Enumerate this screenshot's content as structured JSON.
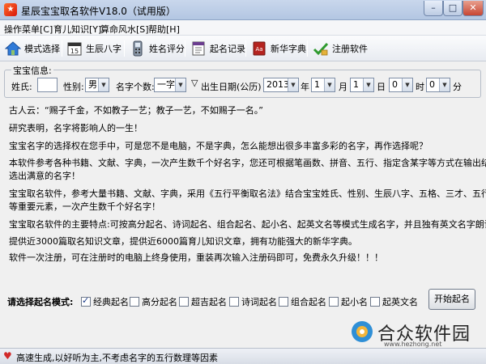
{
  "window": {
    "title": "星辰宝宝取名软件V18.0（试用版）",
    "app_icon": "star-app-icon",
    "buttons": {
      "minimize": "–",
      "maximize": "□",
      "close": "✕"
    }
  },
  "menu": [
    "操作菜单[C]",
    "育儿知识[Y]",
    "算命风水[S]",
    "帮助[H]"
  ],
  "toolbar": [
    {
      "label": "模式选择",
      "icon": "house-icon"
    },
    {
      "label": "生辰八字",
      "icon": "calendar-icon"
    },
    {
      "label": "姓名评分",
      "icon": "phone-icon"
    },
    {
      "label": "起名记录",
      "icon": "record-icon"
    },
    {
      "label": "新华字典",
      "icon": "dictionary-icon"
    },
    {
      "label": "注册软件",
      "icon": "register-icon"
    }
  ],
  "form": {
    "legend": "宝宝信息:",
    "surname_label": "姓氏:",
    "surname_value": "",
    "gender_label": "性别:",
    "gender_value": "男",
    "count_label": "名字个数:",
    "count_value": "一字",
    "birth_marker": "▽",
    "birth_label": "出生日期(公历)",
    "year_value": "2013",
    "year_unit": "年",
    "month_value": "1",
    "month_unit": "月",
    "day_value": "1",
    "day_unit": "日",
    "hour_value": "0",
    "hour_unit": "时",
    "minute_value": "0",
    "minute_unit": "分"
  },
  "content": [
    "古人云：“赐子千金，不如教子一艺；教子一艺，不如赐子一名。”",
    "研究表明，名字将影响人的一生！",
    "宝宝名字的选择权在您手中，可是您不是电脑，不是字典，怎么能想出很多丰富多彩的名字，再作选择呢？",
    "本软件参考各种书籍、文献、字典，一次产生数千个好名字，您还可根据笔画数、拼音、五行、指定含某字等方式在输出结果里筛",
    "选出满意的名字！",
    "宝宝取名软件，参考大量书籍、文献、字典，采用《五行平衡取名法》结合宝宝姓氏、性别、生辰八字、五格、三才、五行及音行意",
    "等重要元素，一次产生数千个好名字！",
    "宝宝取名软件的主要特点:可按高分起名、诗词起名、组合起名、起小名、起英文名等模式生成名字，并且独有英文名字朗读功能。",
    "提供近3000篇取名知识文章，提供近6000篇育儿知识文章，拥有功能强大的新华字典。",
    "软件一次注册，可在注册时的电脑上终身使用，重装再次输入注册码即可，免费永久升级！！！"
  ],
  "modes": {
    "label": "请选择起名模式:",
    "options": [
      {
        "label": "经典起名",
        "checked": true
      },
      {
        "label": "高分起名",
        "checked": false
      },
      {
        "label": "超吉起名",
        "checked": false
      },
      {
        "label": "诗词起名",
        "checked": false
      },
      {
        "label": "组合起名",
        "checked": false
      },
      {
        "label": "起小名",
        "checked": false
      },
      {
        "label": "起英文名",
        "checked": false
      }
    ],
    "start_button": "开始起名"
  },
  "status": {
    "icon": "heart-icon",
    "text": "高速生成,以好听为主,不考虑名字的五行数理等因素"
  },
  "watermark": {
    "main": "合众软件园",
    "sub": "www.hezhong.net"
  }
}
